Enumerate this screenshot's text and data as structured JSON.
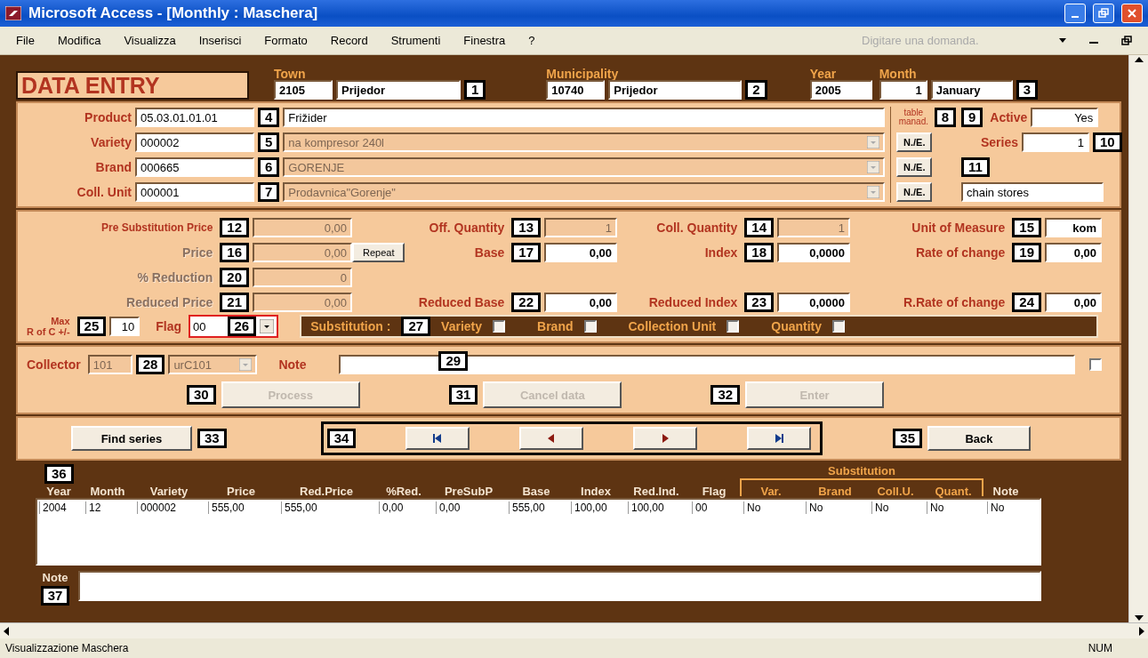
{
  "window": {
    "title": "Microsoft Access - [Monthly : Maschera]"
  },
  "menu": [
    {
      "label": "File"
    },
    {
      "label": "Modifica"
    },
    {
      "label": "Visualizza"
    },
    {
      "label": "Inserisci"
    },
    {
      "label": "Formato"
    },
    {
      "label": "Record"
    },
    {
      "label": "Strumenti"
    },
    {
      "label": "Finestra"
    },
    {
      "label": "?"
    }
  ],
  "help_box": {
    "placeholder": "Digitare una domanda."
  },
  "header": {
    "title": "DATA ENTRY",
    "town": {
      "label": "Town",
      "code": "2105",
      "name": "Prijedor",
      "callout": "1"
    },
    "municipality": {
      "label": "Municipality",
      "code": "10740",
      "name": "Prijedor",
      "callout": "2"
    },
    "year": {
      "label": "Year",
      "value": "2005"
    },
    "month": {
      "label": "Month",
      "number": "1",
      "name": "January",
      "callout": "3"
    }
  },
  "product_rows": [
    {
      "label": "Product",
      "code": "05.03.01.01.01",
      "callout": "4",
      "description": "Frižider",
      "kind": "text",
      "disabled": false
    },
    {
      "label": "Variety",
      "code": "000002",
      "callout": "5",
      "description": "na kompresor 240l",
      "kind": "combo",
      "disabled": true,
      "side_button": "N./E."
    },
    {
      "label": "Brand",
      "code": "000665",
      "callout": "6",
      "description": "GORENJE",
      "kind": "combo",
      "disabled": true,
      "side_button": "N./E."
    },
    {
      "label": "Coll. Unit",
      "code": "000001",
      "callout": "7",
      "description": "Prodavnica\"Gorenje\"",
      "kind": "combo",
      "disabled": true,
      "side_button": "N./E."
    }
  ],
  "table_label": {
    "text": "table manad.",
    "callout": "8"
  },
  "status_panel": {
    "active": {
      "label": "Active",
      "value": "Yes",
      "callout": "9"
    },
    "series": {
      "label": "Series",
      "value": "1",
      "callout": "10"
    },
    "unit_type": {
      "value": "chain stores",
      "callout": "11"
    }
  },
  "price_rows": [
    {
      "cells": [
        {
          "items": [
            {
              "kind": "field",
              "label": "Pre Substitution Price",
              "callout": "12",
              "value": "0,00",
              "disabled": true,
              "label_disabled": false
            }
          ]
        },
        {
          "items": [
            {
              "kind": "field",
              "label": "Off. Quantity",
              "callout": "13",
              "value": "1",
              "disabled": true,
              "label_disabled": false
            }
          ]
        },
        {
          "items": [
            {
              "kind": "field",
              "label": "Coll. Quantity",
              "callout": "14",
              "value": "1",
              "disabled": true,
              "label_disabled": false
            }
          ]
        },
        {
          "items": [
            {
              "kind": "field",
              "label": "Unit of Measure",
              "callout": "15",
              "value": "kom",
              "disabled": false,
              "label_disabled": false
            }
          ]
        }
      ]
    },
    {
      "cells": [
        {
          "items": [
            {
              "kind": "field",
              "label": "Price",
              "callout": "16",
              "value": "0,00",
              "disabled": true,
              "label_disabled": true
            }
          ]
        },
        {
          "items": [
            {
              "kind": "button",
              "label": "Repeat"
            },
            {
              "kind": "field",
              "label": "Base",
              "callout": "17",
              "value": "0,00",
              "disabled": false,
              "label_disabled": false
            }
          ]
        },
        {
          "items": [
            {
              "kind": "field",
              "label": "Index",
              "callout": "18",
              "value": "0,0000",
              "disabled": false,
              "label_disabled": false
            }
          ]
        },
        {
          "items": [
            {
              "kind": "field",
              "label": "Rate of change",
              "callout": "19",
              "value": "0,00",
              "disabled": false,
              "label_disabled": false
            }
          ]
        }
      ]
    },
    {
      "cells": [
        {
          "items": [
            {
              "kind": "field",
              "label": "% Reduction",
              "callout": "20",
              "value": "0",
              "disabled": true,
              "label_disabled": true
            }
          ]
        }
      ]
    },
    {
      "cells": [
        {
          "items": [
            {
              "kind": "field",
              "label": "Reduced Price",
              "callout": "21",
              "value": "0,00",
              "disabled": true,
              "label_disabled": true
            }
          ]
        },
        {
          "items": [
            {
              "kind": "field",
              "label": "Reduced Base",
              "callout": "22",
              "value": "0,00",
              "disabled": false,
              "label_disabled": false
            }
          ]
        },
        {
          "items": [
            {
              "kind": "field",
              "label": "Reduced Index",
              "callout": "23",
              "value": "0,0000",
              "disabled": false,
              "label_disabled": false
            }
          ]
        },
        {
          "items": [
            {
              "kind": "field",
              "label": "R.Rate of change",
              "callout": "24",
              "value": "0,00",
              "disabled": false,
              "label_disabled": false
            }
          ]
        }
      ]
    }
  ],
  "flags_row": {
    "max": {
      "label_top": "Max",
      "label": "R of C +/-",
      "value": "10",
      "callout": "25"
    },
    "flag": {
      "label": "Flag",
      "value": "00",
      "callout": "26"
    },
    "substitution": {
      "label": "Substitution :",
      "callout": "27",
      "options": [
        {
          "label": "Variety",
          "checked": false
        },
        {
          "label": "Brand",
          "checked": false
        },
        {
          "label": "Collection Unit",
          "checked": false
        },
        {
          "label": "Quantity",
          "checked": false
        }
      ]
    }
  },
  "collector": {
    "label": "Collector",
    "code": "101",
    "name": "urC101",
    "callout": "28",
    "disabled": true
  },
  "note": {
    "label": "Note",
    "callout": "29",
    "checked": false
  },
  "actions": [
    {
      "label": "Process",
      "callout": "30",
      "disabled": true
    },
    {
      "label": "Cancel data",
      "callout": "31",
      "disabled": true
    },
    {
      "label": "Enter",
      "callout": "32",
      "disabled": true
    }
  ],
  "navigation": {
    "find": {
      "label": "Find series",
      "callout": "33"
    },
    "callout": "34",
    "buttons": [
      {
        "kind": "first"
      },
      {
        "kind": "prev"
      },
      {
        "kind": "next"
      },
      {
        "kind": "last"
      }
    ],
    "back": {
      "label": "Back",
      "callout": "35"
    }
  },
  "history": {
    "callout": "36",
    "group_label": "Substitution",
    "columns": [
      {
        "label": "Year",
        "grouped": false
      },
      {
        "label": "Month",
        "grouped": false
      },
      {
        "label": "Variety",
        "grouped": false
      },
      {
        "label": "Price",
        "grouped": false
      },
      {
        "label": "Red.Price",
        "grouped": false
      },
      {
        "label": "%Red.",
        "grouped": false
      },
      {
        "label": "PreSubP",
        "grouped": false
      },
      {
        "label": "Base",
        "grouped": false
      },
      {
        "label": "Index",
        "grouped": false
      },
      {
        "label": "Red.Ind.",
        "grouped": false
      },
      {
        "label": "Flag",
        "grouped": false
      },
      {
        "label": "Var.",
        "grouped": true
      },
      {
        "label": "Brand",
        "grouped": true
      },
      {
        "label": "Coll.U.",
        "grouped": true
      },
      {
        "label": "Quant.",
        "grouped": true
      },
      {
        "label": "Note",
        "grouped": false
      }
    ],
    "rows": [
      [
        "2004",
        "12",
        "000002",
        "555,00",
        "555,00",
        "0,00",
        "0,00",
        "555,00",
        "100,00",
        "100,00",
        "00",
        "No",
        "No",
        "No",
        "No",
        "No"
      ]
    ],
    "note": {
      "label": "Note",
      "callout": "37"
    }
  },
  "status_bar": {
    "text": "Visualizzazione Maschera",
    "indicator": "NUM"
  }
}
